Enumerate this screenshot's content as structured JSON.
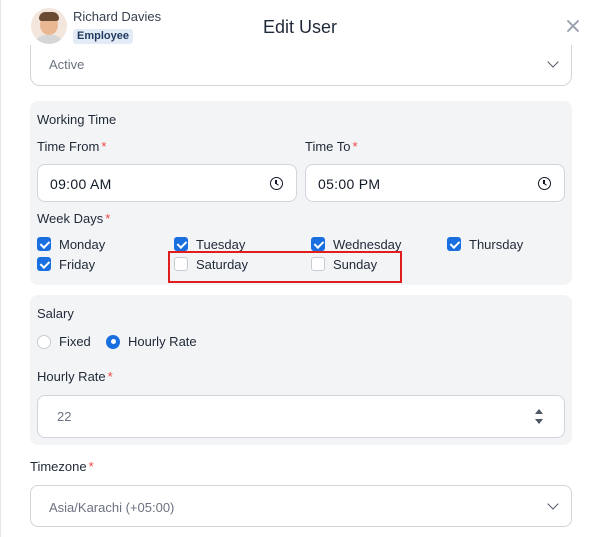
{
  "header": {
    "user_name": "Richard Davies",
    "user_role": "Employee",
    "title": "Edit User",
    "close_icon": "close-icon"
  },
  "status": {
    "value": "Active"
  },
  "working_time": {
    "heading": "Working Time",
    "time_from_label": "Time From",
    "time_from_value": "09:00  AM",
    "time_to_label": "Time To",
    "time_to_value": "05:00  PM",
    "required_mark": "*",
    "week_days_label": "Week Days",
    "days": [
      {
        "label": "Monday",
        "checked": true
      },
      {
        "label": "Tuesday",
        "checked": true
      },
      {
        "label": "Wednesday",
        "checked": true
      },
      {
        "label": "Thursday",
        "checked": true
      },
      {
        "label": "Friday",
        "checked": true
      },
      {
        "label": "Saturday",
        "checked": false
      },
      {
        "label": "Sunday",
        "checked": false
      }
    ]
  },
  "salary": {
    "heading": "Salary",
    "options": [
      {
        "label": "Fixed",
        "selected": false
      },
      {
        "label": "Hourly Rate",
        "selected": true
      }
    ],
    "hourly_rate_label": "Hourly Rate",
    "hourly_rate_value": "22"
  },
  "timezone": {
    "label": "Timezone",
    "value": "Asia/Karachi (+05:00)"
  },
  "colors": {
    "accent": "#1a6fe0",
    "required": "#ef4444",
    "highlight": "#e11d1d"
  }
}
